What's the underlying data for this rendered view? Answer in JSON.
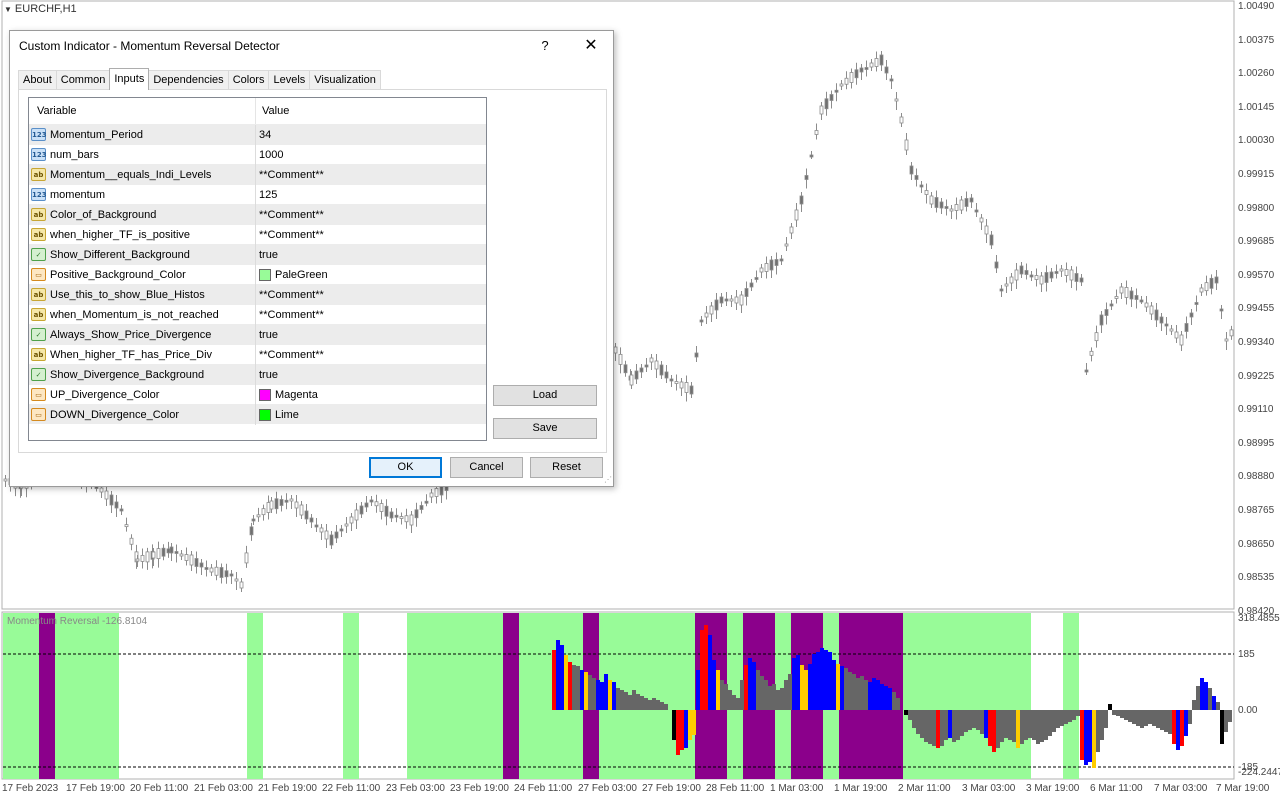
{
  "chart": {
    "symbol_label": "EURCHF,H1",
    "indicator_label": "Momentum Reversal -126.8104",
    "price_axis": [
      "1.00490",
      "1.00375",
      "1.00260",
      "1.00145",
      "1.00030",
      "0.99915",
      "0.99800",
      "0.99685",
      "0.99570",
      "0.99455",
      "0.99340",
      "0.99225",
      "0.99110",
      "0.98995",
      "0.98880",
      "0.98765",
      "0.98650",
      "0.98535",
      "0.98420"
    ],
    "indicator_axis": [
      "318.4855",
      "185",
      "0.00",
      "-185",
      "-224.2447"
    ],
    "time_axis": [
      "17 Feb 2023",
      "17 Feb 19:00",
      "20 Feb 11:00",
      "21 Feb 03:00",
      "21 Feb 19:00",
      "22 Feb 11:00",
      "23 Feb 03:00",
      "23 Feb 19:00",
      "24 Feb 11:00",
      "27 Feb 03:00",
      "27 Feb 19:00",
      "28 Feb 11:00",
      "1 Mar 03:00",
      "1 Mar 19:00",
      "2 Mar 11:00",
      "3 Mar 03:00",
      "3 Mar 19:00",
      "6 Mar 11:00",
      "7 Mar 03:00",
      "7 Mar 19:00"
    ],
    "colors": {
      "positive_background": "#98fb98",
      "divergence_background": "#8b008b",
      "up_histo": "#0000ff",
      "red_histo": "#ff0000",
      "yellow_histo": "#ffcc00",
      "neutral_histo": "#666666",
      "candles": "#8c8c8c"
    }
  },
  "dialog": {
    "title": "Custom Indicator - Momentum Reversal Detector",
    "help": "?",
    "close": "✕",
    "tabs": [
      {
        "label": "About",
        "active": false
      },
      {
        "label": "Common",
        "active": false
      },
      {
        "label": "Inputs",
        "active": true
      },
      {
        "label": "Dependencies",
        "active": false
      },
      {
        "label": "Colors",
        "active": false
      },
      {
        "label": "Levels",
        "active": false
      },
      {
        "label": "Visualization",
        "active": false
      }
    ],
    "table": {
      "header_variable": "Variable",
      "header_value": "Value",
      "rows": [
        {
          "type": "int",
          "icon": "123",
          "variable": "Momentum_Period",
          "value": "34"
        },
        {
          "type": "int",
          "icon": "123",
          "variable": "num_bars",
          "value": "1000"
        },
        {
          "type": "str",
          "icon": "ab",
          "variable": "Momentum__equals_Indi_Levels",
          "value": "**Comment**"
        },
        {
          "type": "int",
          "icon": "123",
          "variable": "momentum",
          "value": "125"
        },
        {
          "type": "str",
          "icon": "ab",
          "variable": "Color_of_Background",
          "value": "**Comment**"
        },
        {
          "type": "str",
          "icon": "ab",
          "variable": "when_higher_TF_is_positive",
          "value": "**Comment**"
        },
        {
          "type": "bool",
          "icon": "✓",
          "variable": "Show_Different_Background",
          "value": "true"
        },
        {
          "type": "color",
          "icon": "▭",
          "variable": "Positive_Background_Color",
          "value": "PaleGreen",
          "swatch": "#98fb98"
        },
        {
          "type": "str",
          "icon": "ab",
          "variable": "Use_this_to_show_Blue_Histos",
          "value": "**Comment**"
        },
        {
          "type": "str",
          "icon": "ab",
          "variable": "when_Momentum_is_not_reached",
          "value": "**Comment**"
        },
        {
          "type": "bool",
          "icon": "✓",
          "variable": "Always_Show_Price_Divergence",
          "value": "true"
        },
        {
          "type": "str",
          "icon": "ab",
          "variable": "When_higher_TF_has_Price_Div",
          "value": "**Comment**"
        },
        {
          "type": "bool",
          "icon": "✓",
          "variable": "Show_Divergence_Background",
          "value": "true"
        },
        {
          "type": "color",
          "icon": "▭",
          "variable": "UP_Divergence_Color",
          "value": "Magenta",
          "swatch": "#ff00ff"
        },
        {
          "type": "color",
          "icon": "▭",
          "variable": "DOWN_Divergence_Color",
          "value": "Lime",
          "swatch": "#00ff00"
        }
      ]
    },
    "buttons": {
      "load": "Load",
      "save": "Save",
      "ok": "OK",
      "cancel": "Cancel",
      "reset": "Reset"
    }
  }
}
